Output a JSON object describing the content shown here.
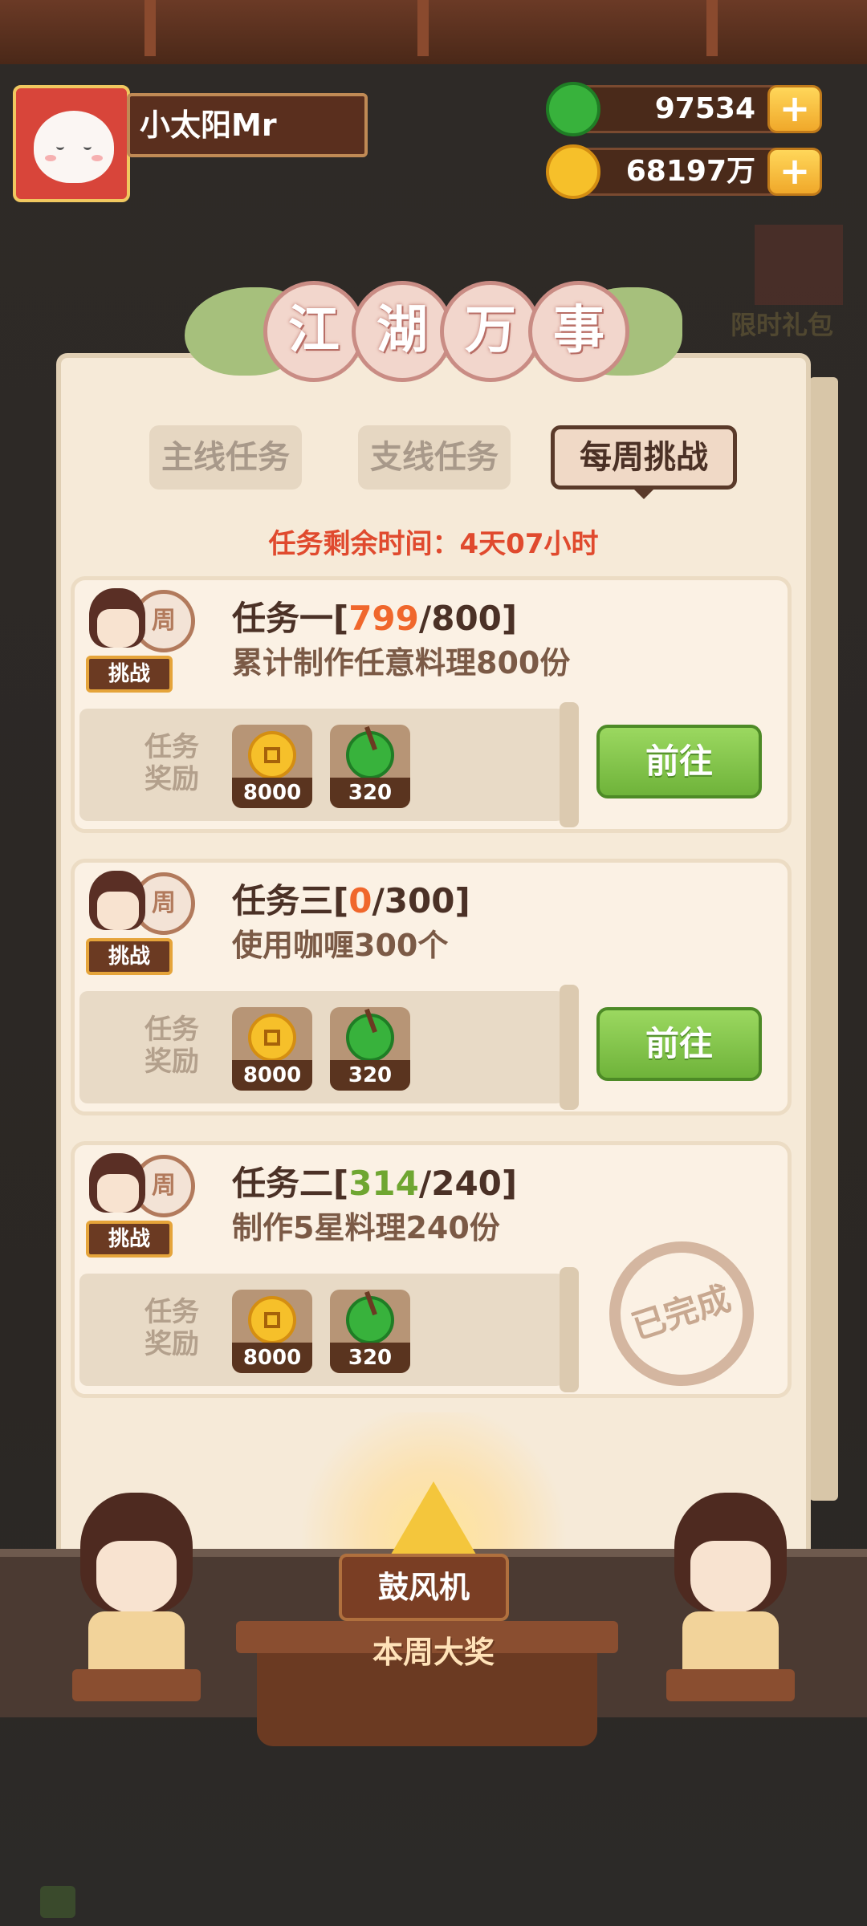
{
  "player": {
    "name": "小太阳Mr"
  },
  "currencies": {
    "jade_amount": "97534",
    "coin_amount": "68197万",
    "plus_label": "+"
  },
  "side_promo": {
    "label": "限时礼包"
  },
  "panel": {
    "title_chars": [
      "江",
      "湖",
      "万",
      "事"
    ],
    "tabs": [
      {
        "label": "主线任务",
        "active": false
      },
      {
        "label": "支线任务",
        "active": false
      },
      {
        "label": "每周挑战",
        "active": true
      }
    ],
    "remaining_time": "任务剩余时间：4天07小时"
  },
  "tasks": [
    {
      "title_prefix": "任务一[",
      "progress_current": "799",
      "progress_sep_total": "/800]",
      "description": "累计制作任意料理800份",
      "badge": "挑战",
      "drum_label": "周",
      "reward_label_line1": "任务",
      "reward_label_line2": "奖励",
      "rewards": [
        {
          "type": "coin",
          "amount": "8000"
        },
        {
          "type": "jade",
          "amount": "320"
        }
      ],
      "action": "前往"
    },
    {
      "title_prefix": "任务三[",
      "progress_current": "0",
      "progress_sep_total": "/300]",
      "description": "使用咖喱300个",
      "badge": "挑战",
      "drum_label": "周",
      "reward_label_line1": "任务",
      "reward_label_line2": "奖励",
      "rewards": [
        {
          "type": "coin",
          "amount": "8000"
        },
        {
          "type": "jade",
          "amount": "320"
        }
      ],
      "action": "前往"
    },
    {
      "title_prefix": "任务二[",
      "progress_current": "314",
      "progress_sep_total": "/240]",
      "description": "制作5星料理240份",
      "badge": "挑战",
      "drum_label": "周",
      "reward_label_line1": "任务",
      "reward_label_line2": "奖励",
      "rewards": [
        {
          "type": "coin",
          "amount": "8000"
        },
        {
          "type": "jade",
          "amount": "320"
        }
      ],
      "status_stamp": "已完成"
    }
  ],
  "bottom": {
    "bellows_label": "鼓风机",
    "weekly_prize_label": "本周大奖"
  },
  "colors": {
    "progress_incomplete": "#f0672c",
    "progress_complete": "#6fa631",
    "remaining_time": "#e04a2e",
    "go_button": "#7dc044"
  }
}
